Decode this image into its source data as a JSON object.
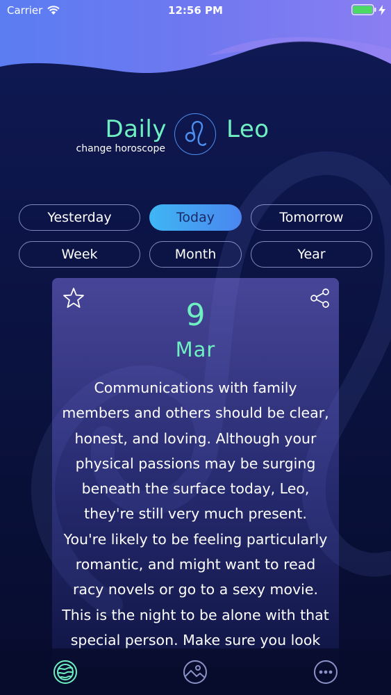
{
  "status_bar": {
    "carrier": "Carrier",
    "time": "12:56 PM",
    "battery_color": "#4cd964"
  },
  "header": {
    "title_left": "Daily",
    "title_right": "Leo",
    "change_link": "change horoscope",
    "sign_icon": "leo-symbol-icon"
  },
  "periods": {
    "row1": [
      "Yesterday",
      "Today",
      "Tomorrow"
    ],
    "row2": [
      "Week",
      "Month",
      "Year"
    ],
    "selected": "Today"
  },
  "card": {
    "day": "9",
    "month": "Mar",
    "text": "Communications with family members and others should be clear, honest, and loving. Although your physical passions may be surging beneath the surface today, Leo, they're still very much present. You're likely to be feeling particularly romantic, and might want to read racy novels or go to a sexy movie. This is the night to be alone with that special person. Make sure you look",
    "favorite_icon": "star-icon",
    "share_icon": "share-icon"
  },
  "tab_bar": {
    "tabs": [
      "horoscope-tab-icon",
      "image-tab-icon",
      "more-tab-icon"
    ],
    "active_color": "#6ff0c2"
  },
  "colors": {
    "accent": "#6ff0c2",
    "pill_active": "#3fb6f4",
    "background": "#0c1446"
  }
}
